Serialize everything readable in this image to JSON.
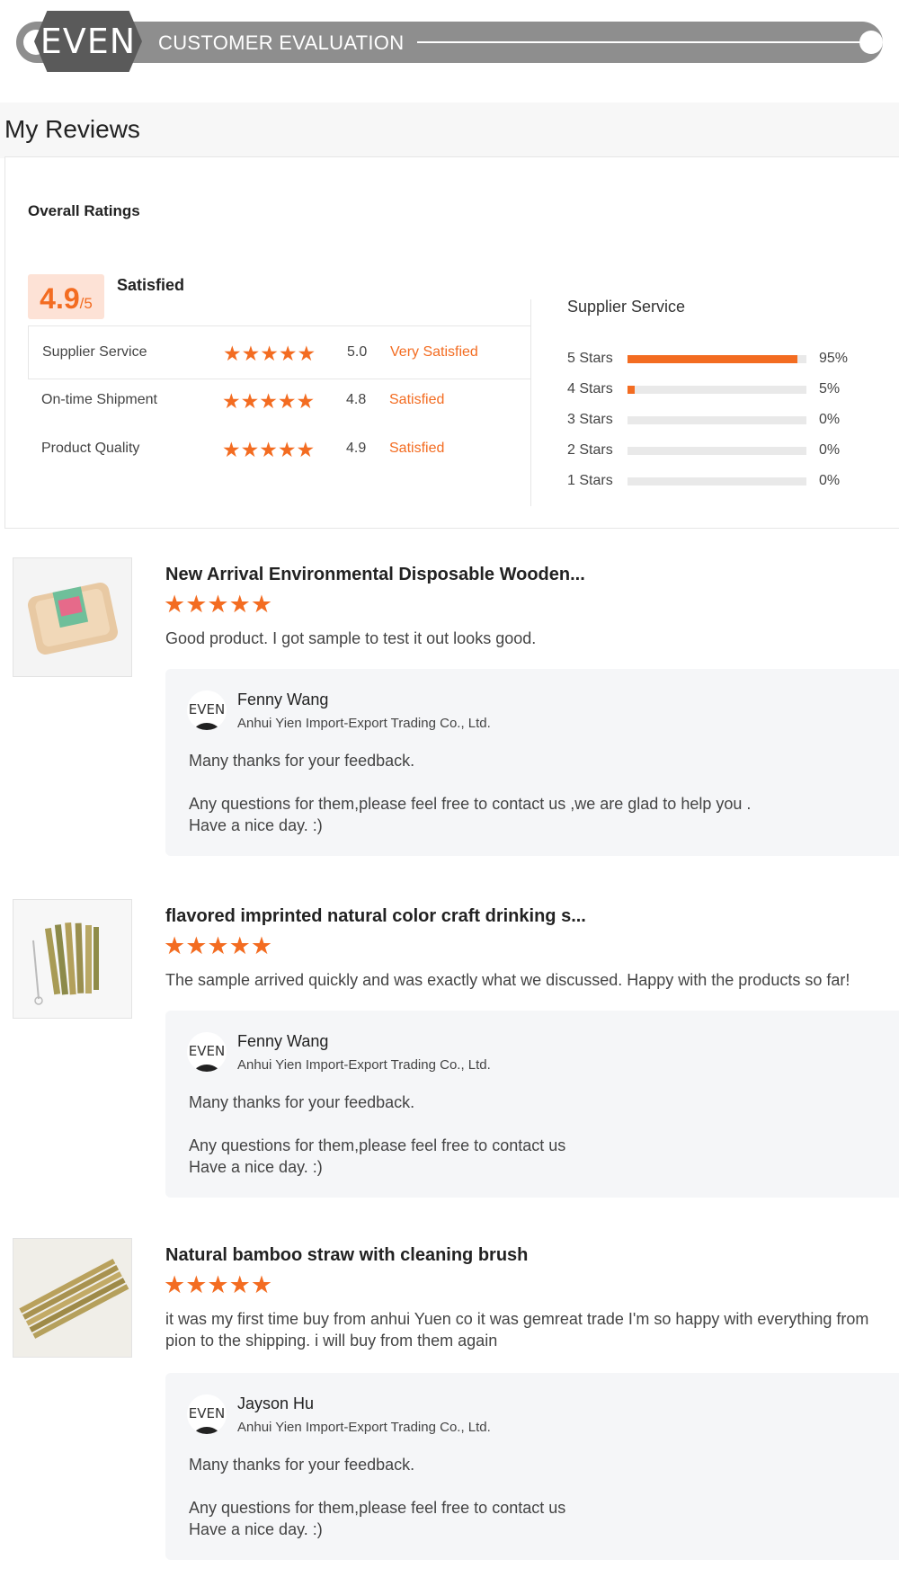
{
  "banner": {
    "logo": "EVEN",
    "title": "CUSTOMER EVALUATION"
  },
  "section": {
    "title": "My Reviews"
  },
  "overall": {
    "label": "Overall Ratings",
    "score": "4.9",
    "score_suffix": "/5",
    "score_word": "Satisfied",
    "rows": [
      {
        "label": "Supplier Service",
        "stars": "★★★★★",
        "value": "5.0",
        "desc": "Very Satisfied"
      },
      {
        "label": "On-time Shipment",
        "stars": "★★★★★",
        "value": "4.8",
        "desc": "Satisfied"
      },
      {
        "label": "Product Quality",
        "stars": "★★★★★",
        "value": "4.9",
        "desc": "Satisfied"
      }
    ]
  },
  "distribution": {
    "title": "Supplier Service",
    "rows": [
      {
        "label": "5 Stars",
        "pct": "95%",
        "fraction": 0.95
      },
      {
        "label": "4 Stars",
        "pct": "5%",
        "fraction": 0.05
      },
      {
        "label": "3 Stars",
        "pct": "0%",
        "fraction": 0
      },
      {
        "label": "2 Stars",
        "pct": "0%",
        "fraction": 0
      },
      {
        "label": "1 Stars",
        "pct": "0%",
        "fraction": 0
      }
    ]
  },
  "reviews": [
    {
      "title": "New Arrival Environmental Disposable Wooden...",
      "stars": "★★★★★",
      "text": "Good product.  I got sample to test it out looks good.",
      "reply": {
        "avatar": "EVEN",
        "name": "Fenny Wang",
        "company": "Anhui Yien Import-Export Trading Co., Ltd.",
        "line1": "Many thanks for your feedback.",
        "line2": "Any questions for them,please feel free to contact us ,we are glad to help you .",
        "line3": "Have a nice day. :)"
      }
    },
    {
      "title": "flavored imprinted natural color craft drinking s...",
      "stars": "★★★★★",
      "text": "The sample arrived quickly and was exactly what we discussed. Happy with the products so far!",
      "reply": {
        "avatar": "EVEN",
        "name": "Fenny Wang",
        "company": "Anhui Yien Import-Export Trading Co., Ltd.",
        "line1": "Many thanks for your feedback.",
        "line2": "Any questions for them,please feel free to contact us",
        "line3": "Have a nice day. :)"
      }
    },
    {
      "title": "Natural bamboo straw with cleaning brush",
      "stars": "★★★★★",
      "text": "it was my first time buy from anhui Yuen co it was gemreat trade I'm so happy with everything from pion to the shipping. i will buy from them again",
      "reply": {
        "avatar": "EVEN",
        "name": "Jayson Hu",
        "company": "Anhui Yien Import-Export Trading Co., Ltd.",
        "line1": "Many thanks for your feedback.",
        "line2": "Any questions for them,please feel free to contact us",
        "line3": "Have a nice day. :)"
      }
    }
  ]
}
